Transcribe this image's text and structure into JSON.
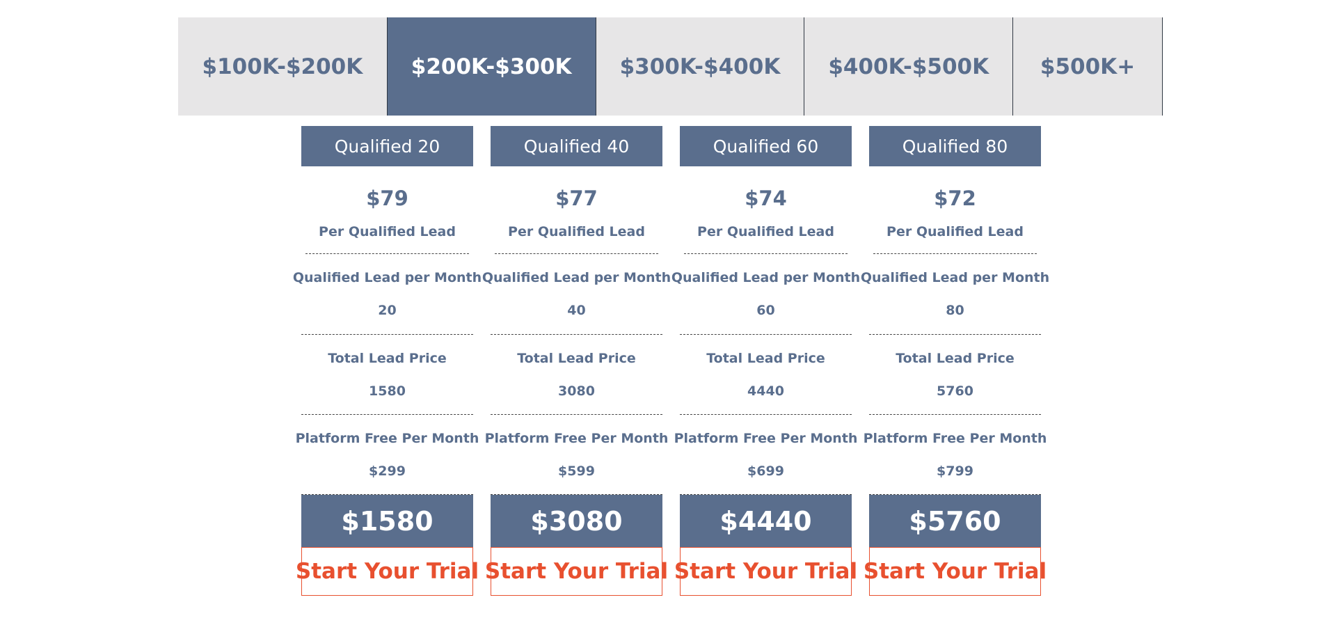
{
  "colors": {
    "accent": "#5a6e8d",
    "tab_bg": "#e7e6e7",
    "cta": "#e8502f"
  },
  "tabs": [
    {
      "label": "$100K-$200K",
      "active": false
    },
    {
      "label": "$200K-$300K",
      "active": true
    },
    {
      "label": "$300K-$400K",
      "active": false
    },
    {
      "label": "$400K-$500K",
      "active": false
    },
    {
      "label": "$500K+",
      "active": false
    }
  ],
  "plans": [
    {
      "header": "Qualified 20",
      "unit_price": "$79",
      "unit_label": "Per Qualified Lead",
      "leads_label": "Qualified Lead per Month",
      "leads_value": "20",
      "total_label": "Total Lead Price",
      "total_value": "1580",
      "platform_label": "Platform Free Per Month",
      "platform_value": "$299",
      "grand_total": "$1580",
      "cta": "Start Your Trial"
    },
    {
      "header": "Qualified 40",
      "unit_price": "$77",
      "unit_label": "Per Qualified Lead",
      "leads_label": "Qualified Lead per Month",
      "leads_value": "40",
      "total_label": "Total Lead Price",
      "total_value": "3080",
      "platform_label": "Platform Free Per Month",
      "platform_value": "$599",
      "grand_total": "$3080",
      "cta": "Start Your Trial"
    },
    {
      "header": "Qualified 60",
      "unit_price": "$74",
      "unit_label": "Per Qualified Lead",
      "leads_label": "Qualified Lead per Month",
      "leads_value": "60",
      "total_label": "Total Lead Price",
      "total_value": "4440",
      "platform_label": "Platform Free Per Month",
      "platform_value": "$699",
      "grand_total": "$4440",
      "cta": "Start Your Trial"
    },
    {
      "header": "Qualified 80",
      "unit_price": "$72",
      "unit_label": "Per Qualified Lead",
      "leads_label": "Qualified Lead per Month",
      "leads_value": "80",
      "total_label": "Total Lead Price",
      "total_value": "5760",
      "platform_label": "Platform Free Per Month",
      "platform_value": "$799",
      "grand_total": "$5760",
      "cta": "Start Your Trial"
    }
  ]
}
